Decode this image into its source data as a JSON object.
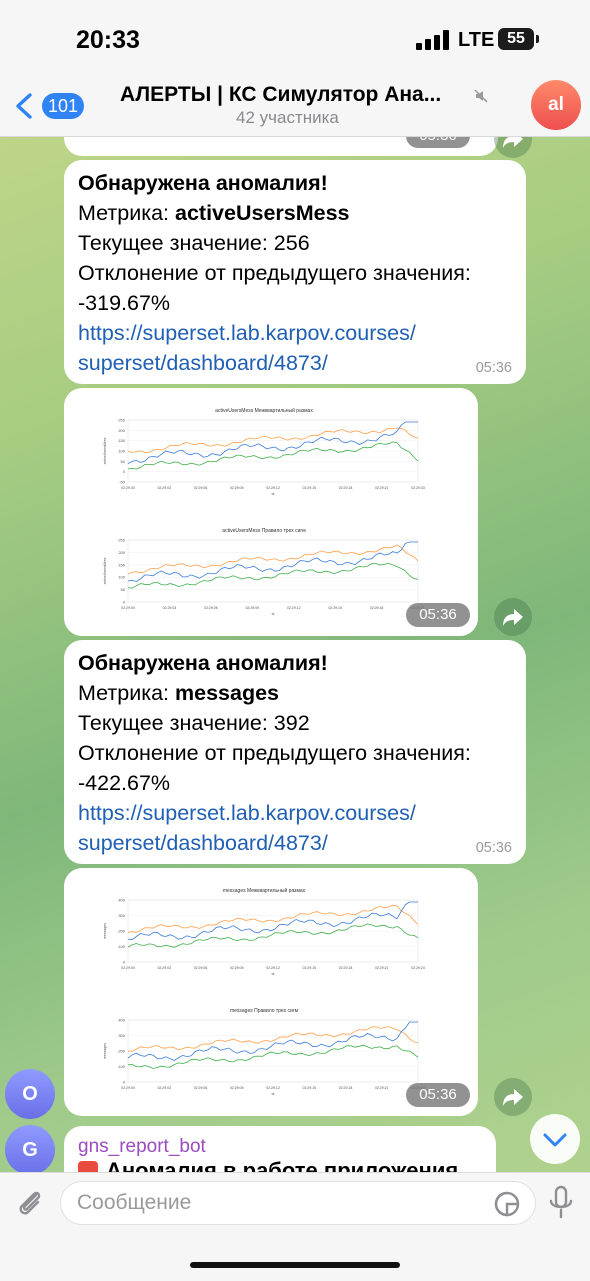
{
  "status_bar": {
    "time": "20:33",
    "network": "LTE",
    "battery": "55"
  },
  "header": {
    "back_count": "101",
    "title": "АЛЕРТЫ | КС Симулятор Ана...",
    "subtitle": "42 участника",
    "avatar_initials": "al"
  },
  "top_partial": {
    "time": "05:36"
  },
  "messages": [
    {
      "heading": "Обнаружена аномалия!",
      "metric_label": "Метрика: ",
      "metric_value": "activeUsersMess",
      "current_value": "Текущее значение: 256",
      "deviation_label": "Отклонение от предыдущего значения:",
      "deviation_value": "-319.67%",
      "link_line1": "https://superset.lab.karpov.courses/",
      "link_line2": "superset/dashboard/4873/",
      "time": "05:36"
    },
    {
      "heading": "Обнаружена аномалия!",
      "metric_label": "Метрика: ",
      "metric_value": "messages",
      "current_value": "Текущее значение: 392",
      "deviation_label": "Отклонение от предыдущего значения:",
      "deviation_value": "-422.67%",
      "link_line1": "https://superset.lab.karpov.courses/",
      "link_line2": "superset/dashboard/4873/",
      "time": "05:36"
    }
  ],
  "images": [
    {
      "time": "05:36",
      "charts": [
        {
          "title": "activeUsersMess Межквартильный размах",
          "ylabel": "activeUsersMess",
          "xlabel": "ts",
          "yticks": [
            "250",
            "200",
            "150",
            "100",
            "50",
            "0",
            "-50"
          ],
          "xticks": [
            "02:29:30",
            "02:29:03",
            "02:29:06",
            "02:29:09",
            "02:29:12",
            "02:29:15",
            "02:29:18",
            "02:29:21",
            "02:29:33"
          ]
        },
        {
          "title": "activeUsersMess Правило трех сигм",
          "ylabel": "activeUsersMess",
          "xlabel": "ts",
          "yticks": [
            "250",
            "200",
            "150",
            "100",
            "50",
            "0"
          ],
          "xticks": [
            "02:29:00",
            "02:29:03",
            "02:29:06",
            "02:29:09",
            "02:29:12",
            "02:29:15",
            "02:29:18",
            "02:29:21"
          ]
        }
      ]
    },
    {
      "time": "05:36",
      "charts": [
        {
          "title": "messages Межквартильный размах",
          "ylabel": "messages",
          "xlabel": "ts",
          "yticks": [
            "400",
            "300",
            "200",
            "100",
            "0"
          ],
          "xticks": [
            "02:29:00",
            "02:29:03",
            "02:29:06",
            "02:29:09",
            "02:29:12",
            "02:29:15",
            "02:29:18",
            "02:29:21",
            "02:29:24"
          ]
        },
        {
          "title": "messages Правило трех сигм",
          "ylabel": "messages",
          "xlabel": "ts",
          "yticks": [
            "400",
            "300",
            "200",
            "100",
            "0"
          ],
          "xticks": [
            "02:29:00",
            "02:29:03",
            "02:29:06",
            "02:29:09",
            "02:29:12",
            "02:29:15",
            "02:29:18",
            "02:29:21",
            "02:29:24"
          ]
        }
      ]
    }
  ],
  "sender_avatars": [
    {
      "initial": "O"
    },
    {
      "initial": "G"
    }
  ],
  "bot_message": {
    "sender": "gns_report_bot",
    "text": "Аномалия в работе приложения"
  },
  "input": {
    "placeholder": "Сообщение"
  },
  "colors": {
    "accent": "#2f83f5",
    "link": "#1f5fb4",
    "upper_band": "#ff9f4a",
    "series": "#3b7dd8",
    "lower_band": "#3fae49"
  }
}
